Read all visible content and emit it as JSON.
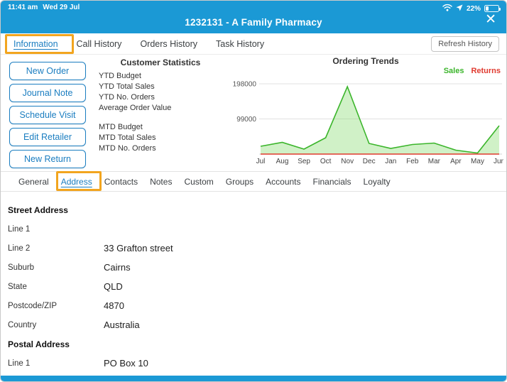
{
  "statusbar": {
    "time": "11:41 am",
    "date": "Wed 29 Jul",
    "battery": "22%"
  },
  "header": {
    "title": "1232131 - A Family Pharmacy"
  },
  "icons": {
    "close": "✕",
    "wifi": "wifi-arcs",
    "location": "navigation-arrow",
    "battery": "battery-outline"
  },
  "tabs": {
    "items": [
      {
        "label": "Information",
        "active": true
      },
      {
        "label": "Call History",
        "active": false
      },
      {
        "label": "Orders History",
        "active": false
      },
      {
        "label": "Task History",
        "active": false
      }
    ],
    "refresh_button": "Refresh History"
  },
  "actions": {
    "buttons": [
      "New Order",
      "Journal Note",
      "Schedule Visit",
      "Edit Retailer",
      "New Return"
    ]
  },
  "customer_statistics": {
    "title": "Customer Statistics",
    "rows_group1": [
      "YTD Budget",
      "YTD Total Sales",
      "YTD No. Orders",
      "Average Order Value"
    ],
    "rows_group2": [
      "MTD Budget",
      "MTD Total Sales",
      "MTD No. Orders"
    ]
  },
  "chart_data": {
    "type": "area",
    "title": "Ordering Trends",
    "categories": [
      "Jul",
      "Aug",
      "Sep",
      "Oct",
      "Nov",
      "Dec",
      "Jan",
      "Feb",
      "Mar",
      "Apr",
      "May",
      "Jun"
    ],
    "series": [
      {
        "name": "Sales",
        "color": "#3bb52b",
        "fill": "rgba(120,214,95,0.35)",
        "values": [
          22000,
          33000,
          14000,
          46000,
          190000,
          30000,
          16000,
          27000,
          31000,
          11000,
          3000,
          80000
        ]
      },
      {
        "name": "Returns",
        "color": "#e03a2f",
        "values": [
          0,
          0,
          0,
          0,
          0,
          0,
          0,
          0,
          0,
          0,
          0,
          0
        ]
      }
    ],
    "xlabel": "",
    "ylabel": "",
    "ylim": [
      0,
      232000
    ],
    "yticks": [
      99000,
      198000
    ],
    "legend_position": "top-right",
    "grid": true
  },
  "subtabs": {
    "items": [
      {
        "label": "General",
        "active": false
      },
      {
        "label": "Address",
        "active": true
      },
      {
        "label": "Contacts",
        "active": false
      },
      {
        "label": "Notes",
        "active": false
      },
      {
        "label": "Custom",
        "active": false
      },
      {
        "label": "Groups",
        "active": false
      },
      {
        "label": "Accounts",
        "active": false
      },
      {
        "label": "Financials",
        "active": false
      },
      {
        "label": "Loyalty",
        "active": false
      }
    ]
  },
  "address_form": {
    "sections": [
      {
        "header": "Street Address",
        "fields": [
          {
            "label": "Line 1",
            "value": ""
          },
          {
            "label": "Line 2",
            "value": "33 Grafton street"
          },
          {
            "label": "Suburb",
            "value": "Cairns"
          },
          {
            "label": "State",
            "value": "QLD"
          },
          {
            "label": "Postcode/ZIP",
            "value": "4870"
          },
          {
            "label": "Country",
            "value": "Australia"
          }
        ]
      },
      {
        "header": "Postal Address",
        "fields": [
          {
            "label": "Line 1",
            "value": "PO Box 10"
          }
        ]
      }
    ]
  },
  "colors": {
    "topbar_blue": "#1b99d5",
    "accent_blue": "#1a7dc0",
    "highlight_orange": "#f2a51f",
    "sales_green": "#3bb52b",
    "returns_red": "#e03a2f"
  }
}
